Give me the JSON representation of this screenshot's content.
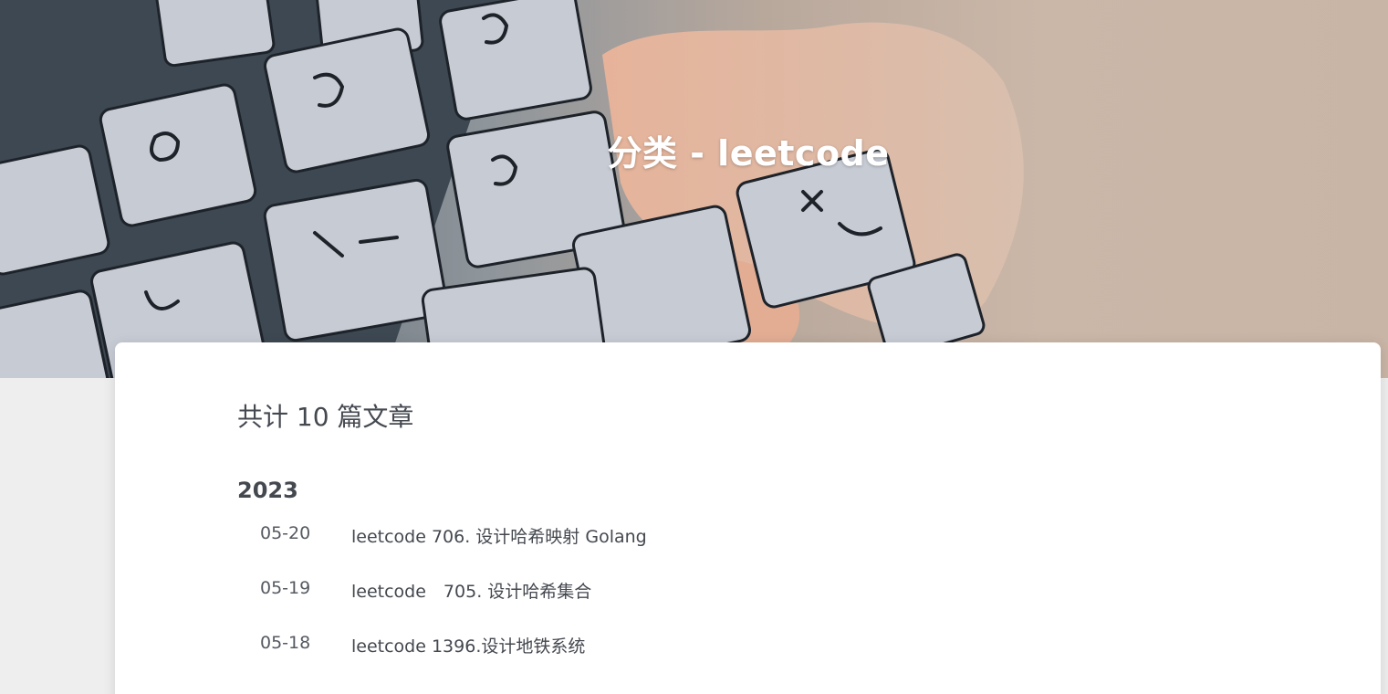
{
  "hero": {
    "title": "分类 - leetcode"
  },
  "main": {
    "summary": "共计 10 篇文章",
    "year": "2023",
    "posts": [
      {
        "date": "05-20",
        "title": "leetcode 706. 设计哈希映射 Golang"
      },
      {
        "date": "05-19",
        "title": "leetcode　705. 设计哈希集合"
      },
      {
        "date": "05-18",
        "title": "leetcode 1396.设计地铁系统"
      }
    ]
  },
  "colors": {
    "page_background": "#eeeeee",
    "card_background": "#ffffff",
    "text": "#44484f",
    "hero_title": "#ffffff"
  }
}
